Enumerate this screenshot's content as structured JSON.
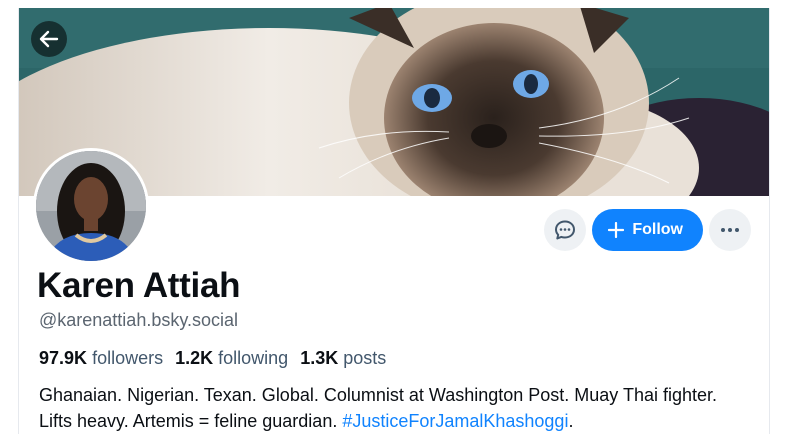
{
  "profile": {
    "display_name": "Karen Attiah",
    "handle": "@karenattiah.bsky.social",
    "stats": {
      "followers_count": "97.9K",
      "followers_label": "followers",
      "following_count": "1.2K",
      "following_label": "following",
      "posts_count": "1.3K",
      "posts_label": "posts"
    },
    "bio_text": "Ghanaian. Nigerian. Texan. Global. Columnist at Washington Post. Muay Thai fighter. Lifts heavy. Artemis = feline guardian. ",
    "bio_hashtag": "#JusticeForJamalKhashoggi",
    "bio_end": "."
  },
  "actions": {
    "message_icon": "chat-bubble-icon",
    "follow_label": "Follow",
    "more_icon": "ellipsis-icon"
  },
  "nav": {
    "back_icon": "arrow-left-icon"
  },
  "colors": {
    "accent": "#1083fe",
    "text": "#0b0f14",
    "muted": "#5b6570",
    "icon_button_bg": "#eef1f4"
  }
}
